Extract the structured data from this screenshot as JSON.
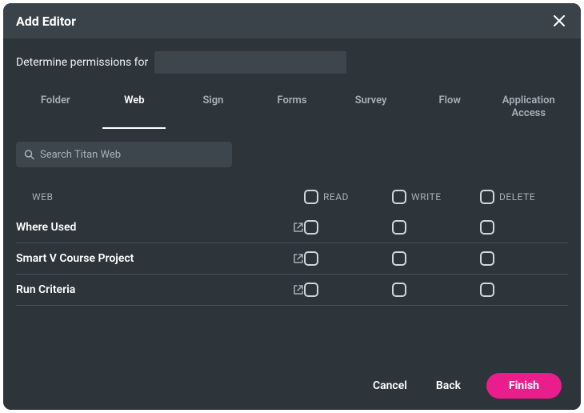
{
  "dialog": {
    "title": "Add  Editor",
    "determine_label": "Determine permissions for"
  },
  "tabs": [
    {
      "label": "Folder"
    },
    {
      "label": "Web"
    },
    {
      "label": "Sign"
    },
    {
      "label": "Forms"
    },
    {
      "label": "Survey"
    },
    {
      "label": "Flow"
    },
    {
      "label": "Application Access"
    }
  ],
  "active_tab_index": 1,
  "search": {
    "placeholder": "Search Titan Web",
    "value": ""
  },
  "columns": {
    "name": "WEB",
    "read": "READ",
    "write": "WRITE",
    "delete": "DELETE"
  },
  "rows": [
    {
      "name": "Where Used",
      "external": true,
      "read": false,
      "write": false,
      "delete": false
    },
    {
      "name": "Smart V Course Project",
      "external": true,
      "read": false,
      "write": false,
      "delete": false
    },
    {
      "name": "Run Criteria",
      "external": true,
      "read": false,
      "write": false,
      "delete": false
    }
  ],
  "footer": {
    "cancel": "Cancel",
    "back": "Back",
    "finish": "Finish"
  }
}
